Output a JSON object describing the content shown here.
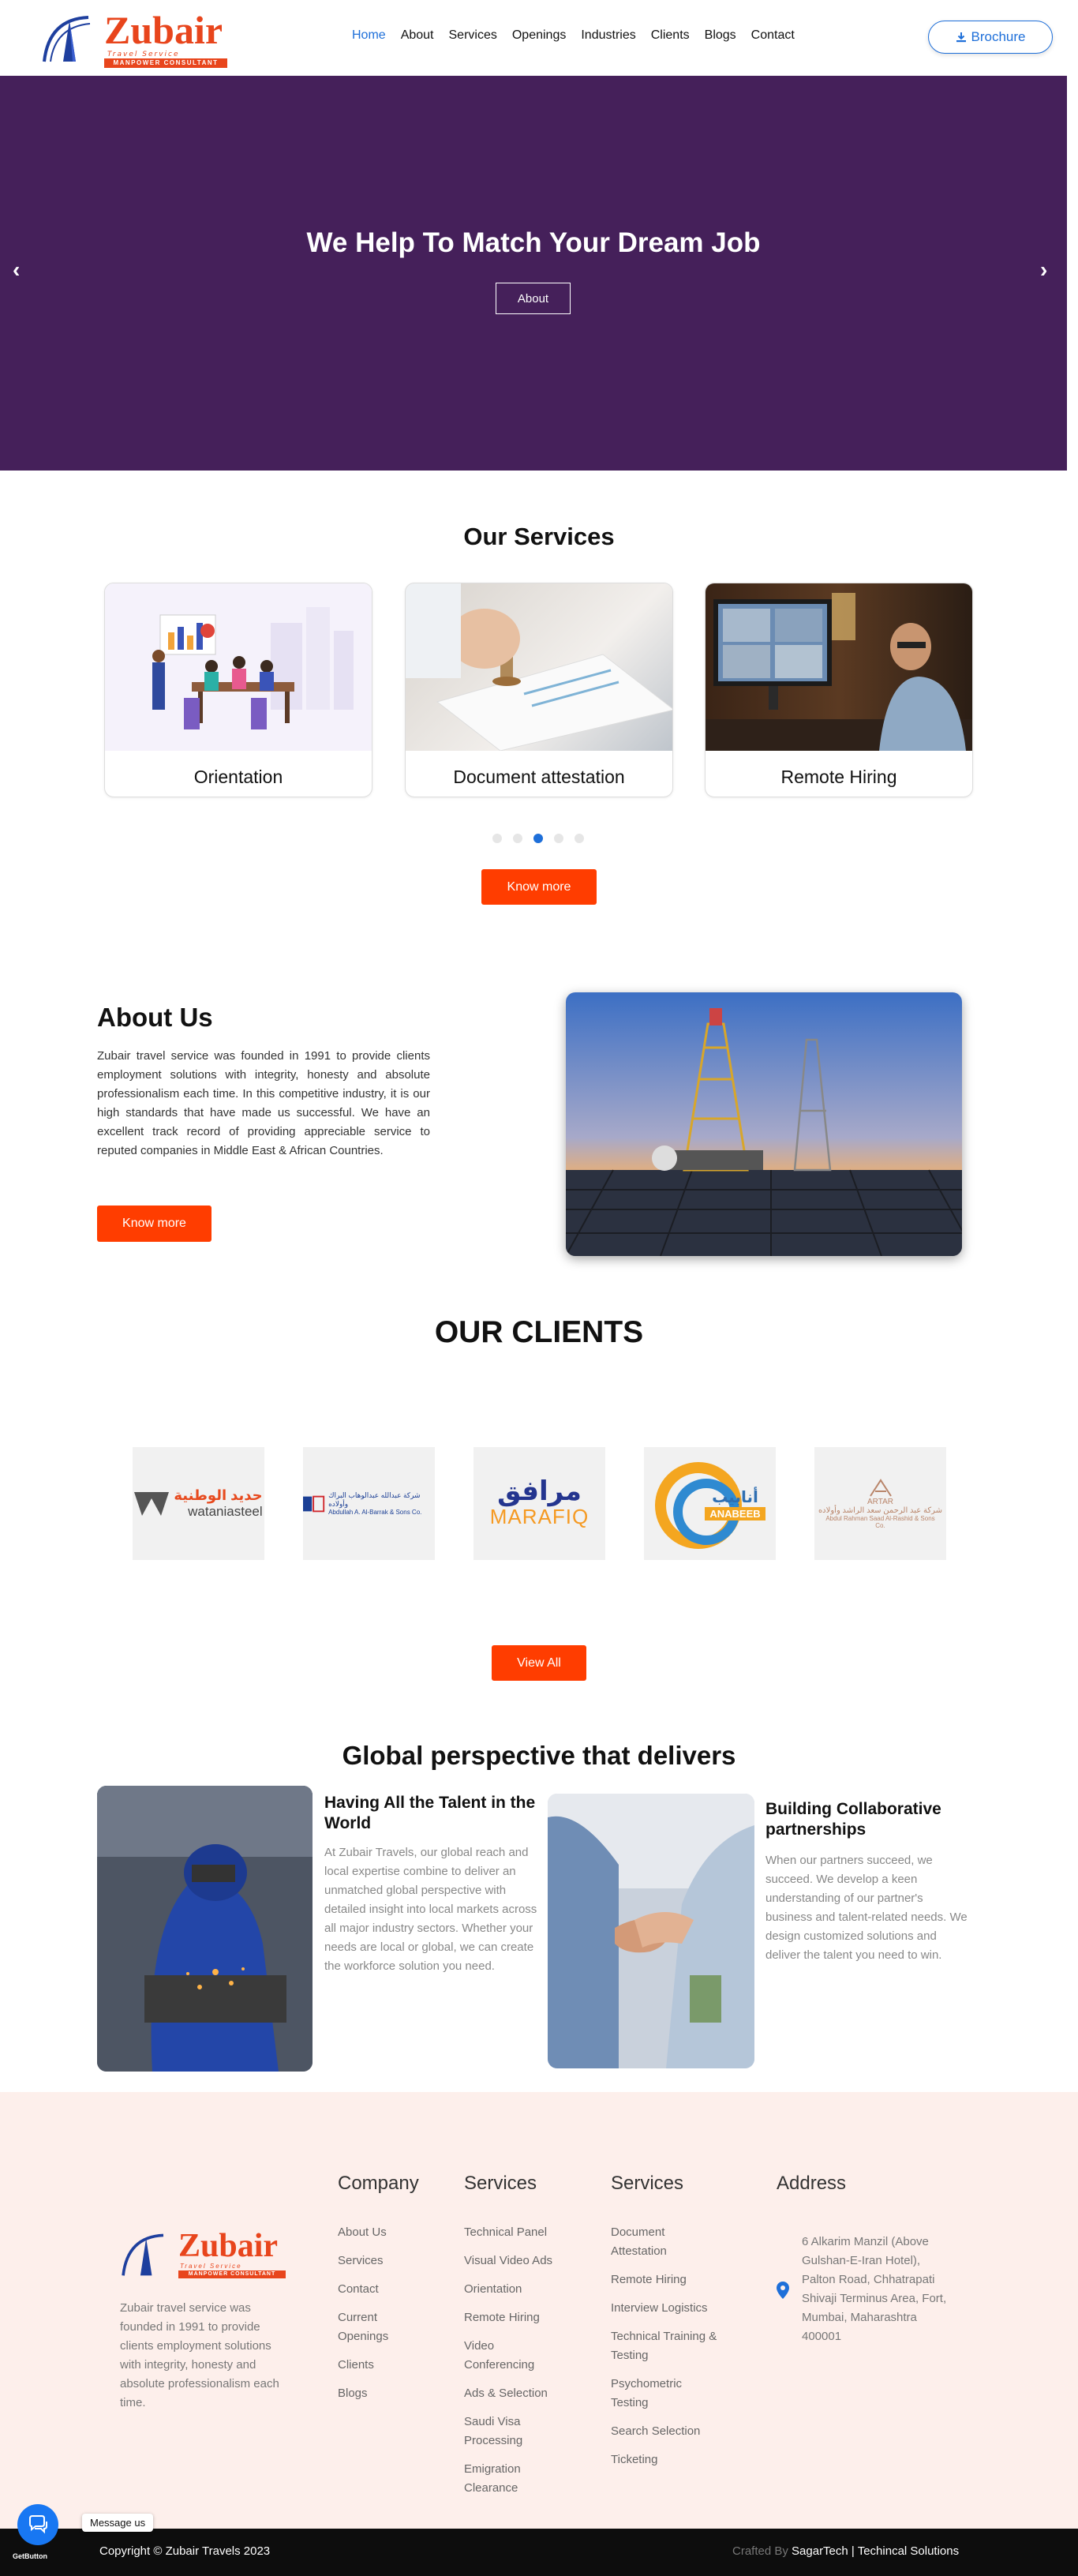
{
  "brand": {
    "name": "Zubair",
    "tagline": "Travel Service",
    "subtitle": "MANPOWER CONSULTANT",
    "primary_color": "#1e6fd9",
    "accent_color": "#ff3d00",
    "hero_color": "#45205a"
  },
  "nav": {
    "items": [
      "Home",
      "About",
      "Services",
      "Openings",
      "Industries",
      "Clients",
      "Blogs",
      "Contact"
    ],
    "active": "Home",
    "brochure_label": "Brochure",
    "brochure_icon": "download-icon"
  },
  "hero": {
    "title": "We Help To Match Your Dream Job",
    "button": "About",
    "prev_icon": "chevron-left-icon",
    "next_icon": "chevron-right-icon"
  },
  "services": {
    "title": "Our Services",
    "cards": [
      {
        "label": "Orientation"
      },
      {
        "label": "Document attestation"
      },
      {
        "label": "Remote Hiring"
      }
    ],
    "carousel": {
      "total_dots": 5,
      "active_index": 2
    },
    "button": "Know more"
  },
  "about": {
    "title": "About Us",
    "text": "Zubair travel service was founded in 1991 to provide clients employment solutions with integrity, honesty and absolute professionalism each time. In this competitive industry, it is our high standards that have made us successful. We have an excellent track record of providing appreciable service to reputed companies in Middle East & African Countries.",
    "button": "Know more"
  },
  "clients": {
    "title": "OUR CLIENTS",
    "logos": [
      {
        "arabic": "حديد الوطنية",
        "name": "wataniasteel"
      },
      {
        "arabic": "شركة عبدالله عبدالوهاب البراك وأولاده",
        "name": "Abdullah A. Al-Barrak & Sons Co."
      },
      {
        "arabic": "مرافق",
        "name": "MARAFIQ"
      },
      {
        "arabic": "أنابيب",
        "name": "ANABEEB"
      },
      {
        "arabic": "شركة عبد الرحمن سعد الراشد وأولاده",
        "name": "Abdul Rahman Saad Al-Rashid & Sons Co.",
        "short": "ARTAR"
      }
    ],
    "button": "View All"
  },
  "global": {
    "title": "Global perspective that delivers",
    "items": [
      {
        "heading": "Having All the Talent in the World",
        "text": "At Zubair Travels, our global reach and local expertise combine to deliver an unmatched global perspective with detailed insight into local markets across all major industry sectors. Whether your needs are local or global, we can create the workforce solution you need."
      },
      {
        "heading": "Building Collaborative partnerships",
        "text": "When our partners succeed, we succeed. We develop a keen understanding of our partner's business and talent-related needs. We design customized solutions and deliver the talent you need to win."
      }
    ]
  },
  "footer": {
    "about": "Zubair travel service was founded in 1991 to provide clients employment solutions with integrity, honesty and absolute professionalism each time.",
    "company": {
      "heading": "Company",
      "links": [
        "About Us",
        "Services",
        "Contact",
        "Current Openings",
        "Clients",
        "Blogs"
      ]
    },
    "services1": {
      "heading": "Services",
      "links": [
        "Technical Panel",
        "Visual Video Ads",
        "Orientation",
        "Remote Hiring",
        "Video Conferencing",
        "Ads & Selection",
        "Saudi Visa Processing",
        "Emigration Clearance"
      ]
    },
    "services2": {
      "heading": "Services",
      "links": [
        "Document Attestation",
        "Remote Hiring",
        "Interview Logistics",
        "Technical Training & Testing",
        "Psychometric Testing",
        "Search Selection",
        "Ticketing"
      ]
    },
    "address": {
      "heading": "Address",
      "text": "6 Alkarim Manzil (Above Gulshan-E-Iran Hotel), Palton Road, Chhatrapati Shivaji Terminus Area, Fort, Mumbai, Maharashtra 400001",
      "icon": "map-pin-icon"
    },
    "copyright": "Copyright © Zubair Travels  2023",
    "crafted_prefix": "Crafted By ",
    "crafted_name": "SagarTech | Techincal Solutions"
  },
  "chat": {
    "message": "Message us",
    "badge": "GetButton",
    "icon": "chat-icon"
  }
}
